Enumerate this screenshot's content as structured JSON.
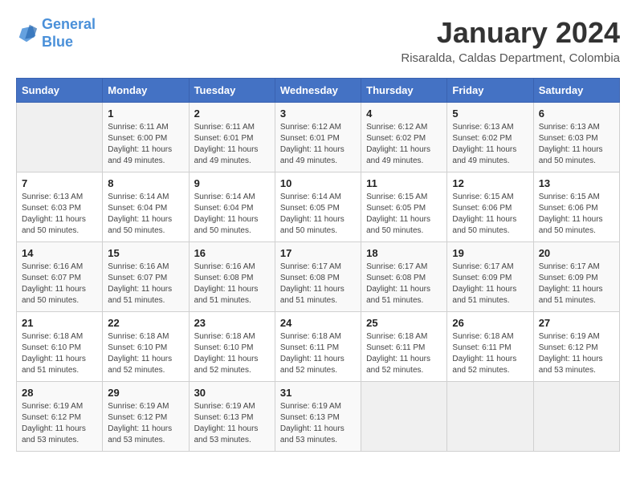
{
  "logo": {
    "line1": "General",
    "line2": "Blue"
  },
  "title": "January 2024",
  "subtitle": "Risaralda, Caldas Department, Colombia",
  "days_of_week": [
    "Sunday",
    "Monday",
    "Tuesday",
    "Wednesday",
    "Thursday",
    "Friday",
    "Saturday"
  ],
  "weeks": [
    [
      {
        "day": "",
        "info": ""
      },
      {
        "day": "1",
        "info": "Sunrise: 6:11 AM\nSunset: 6:00 PM\nDaylight: 11 hours\nand 49 minutes."
      },
      {
        "day": "2",
        "info": "Sunrise: 6:11 AM\nSunset: 6:01 PM\nDaylight: 11 hours\nand 49 minutes."
      },
      {
        "day": "3",
        "info": "Sunrise: 6:12 AM\nSunset: 6:01 PM\nDaylight: 11 hours\nand 49 minutes."
      },
      {
        "day": "4",
        "info": "Sunrise: 6:12 AM\nSunset: 6:02 PM\nDaylight: 11 hours\nand 49 minutes."
      },
      {
        "day": "5",
        "info": "Sunrise: 6:13 AM\nSunset: 6:02 PM\nDaylight: 11 hours\nand 49 minutes."
      },
      {
        "day": "6",
        "info": "Sunrise: 6:13 AM\nSunset: 6:03 PM\nDaylight: 11 hours\nand 50 minutes."
      }
    ],
    [
      {
        "day": "7",
        "info": "Sunrise: 6:13 AM\nSunset: 6:03 PM\nDaylight: 11 hours\nand 50 minutes."
      },
      {
        "day": "8",
        "info": "Sunrise: 6:14 AM\nSunset: 6:04 PM\nDaylight: 11 hours\nand 50 minutes."
      },
      {
        "day": "9",
        "info": "Sunrise: 6:14 AM\nSunset: 6:04 PM\nDaylight: 11 hours\nand 50 minutes."
      },
      {
        "day": "10",
        "info": "Sunrise: 6:14 AM\nSunset: 6:05 PM\nDaylight: 11 hours\nand 50 minutes."
      },
      {
        "day": "11",
        "info": "Sunrise: 6:15 AM\nSunset: 6:05 PM\nDaylight: 11 hours\nand 50 minutes."
      },
      {
        "day": "12",
        "info": "Sunrise: 6:15 AM\nSunset: 6:06 PM\nDaylight: 11 hours\nand 50 minutes."
      },
      {
        "day": "13",
        "info": "Sunrise: 6:15 AM\nSunset: 6:06 PM\nDaylight: 11 hours\nand 50 minutes."
      }
    ],
    [
      {
        "day": "14",
        "info": "Sunrise: 6:16 AM\nSunset: 6:07 PM\nDaylight: 11 hours\nand 50 minutes."
      },
      {
        "day": "15",
        "info": "Sunrise: 6:16 AM\nSunset: 6:07 PM\nDaylight: 11 hours\nand 51 minutes."
      },
      {
        "day": "16",
        "info": "Sunrise: 6:16 AM\nSunset: 6:08 PM\nDaylight: 11 hours\nand 51 minutes."
      },
      {
        "day": "17",
        "info": "Sunrise: 6:17 AM\nSunset: 6:08 PM\nDaylight: 11 hours\nand 51 minutes."
      },
      {
        "day": "18",
        "info": "Sunrise: 6:17 AM\nSunset: 6:08 PM\nDaylight: 11 hours\nand 51 minutes."
      },
      {
        "day": "19",
        "info": "Sunrise: 6:17 AM\nSunset: 6:09 PM\nDaylight: 11 hours\nand 51 minutes."
      },
      {
        "day": "20",
        "info": "Sunrise: 6:17 AM\nSunset: 6:09 PM\nDaylight: 11 hours\nand 51 minutes."
      }
    ],
    [
      {
        "day": "21",
        "info": "Sunrise: 6:18 AM\nSunset: 6:10 PM\nDaylight: 11 hours\nand 51 minutes."
      },
      {
        "day": "22",
        "info": "Sunrise: 6:18 AM\nSunset: 6:10 PM\nDaylight: 11 hours\nand 52 minutes."
      },
      {
        "day": "23",
        "info": "Sunrise: 6:18 AM\nSunset: 6:10 PM\nDaylight: 11 hours\nand 52 minutes."
      },
      {
        "day": "24",
        "info": "Sunrise: 6:18 AM\nSunset: 6:11 PM\nDaylight: 11 hours\nand 52 minutes."
      },
      {
        "day": "25",
        "info": "Sunrise: 6:18 AM\nSunset: 6:11 PM\nDaylight: 11 hours\nand 52 minutes."
      },
      {
        "day": "26",
        "info": "Sunrise: 6:18 AM\nSunset: 6:11 PM\nDaylight: 11 hours\nand 52 minutes."
      },
      {
        "day": "27",
        "info": "Sunrise: 6:19 AM\nSunset: 6:12 PM\nDaylight: 11 hours\nand 53 minutes."
      }
    ],
    [
      {
        "day": "28",
        "info": "Sunrise: 6:19 AM\nSunset: 6:12 PM\nDaylight: 11 hours\nand 53 minutes."
      },
      {
        "day": "29",
        "info": "Sunrise: 6:19 AM\nSunset: 6:12 PM\nDaylight: 11 hours\nand 53 minutes."
      },
      {
        "day": "30",
        "info": "Sunrise: 6:19 AM\nSunset: 6:13 PM\nDaylight: 11 hours\nand 53 minutes."
      },
      {
        "day": "31",
        "info": "Sunrise: 6:19 AM\nSunset: 6:13 PM\nDaylight: 11 hours\nand 53 minutes."
      },
      {
        "day": "",
        "info": ""
      },
      {
        "day": "",
        "info": ""
      },
      {
        "day": "",
        "info": ""
      }
    ]
  ]
}
